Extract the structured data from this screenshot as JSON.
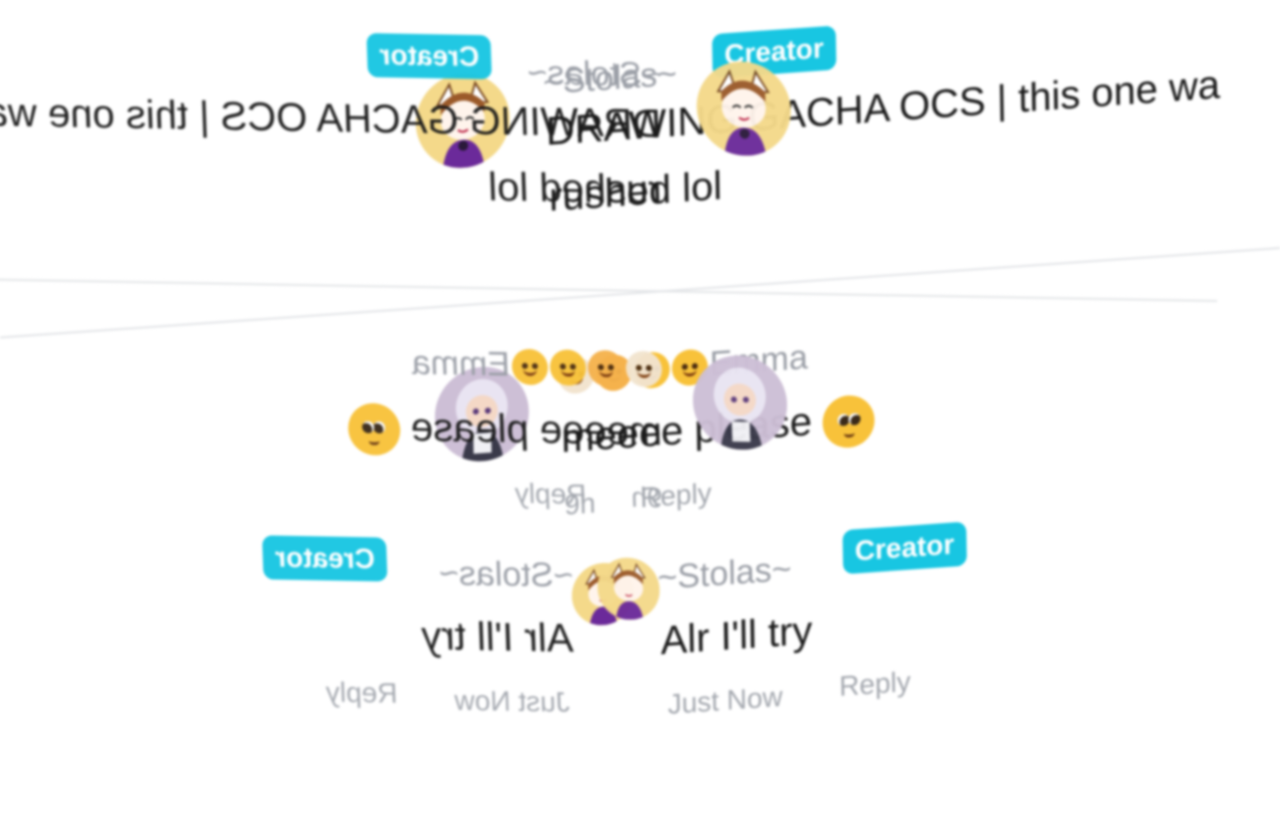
{
  "comments": [
    {
      "author": "~Stolas~",
      "badge": "Creator",
      "text_line1": "DRAWING GACHA OCS | this one wa",
      "text_line2": "rushed lol"
    },
    {
      "author_emojis": [
        "dog-face-emoji",
        "smiling-face-with-hearts-emoji",
        "melting-face-emoji",
        "zany-face-emoji"
      ],
      "author": "Emma",
      "text": "meeee please",
      "text_emoji": "pleading-face-emoji",
      "time": "9h",
      "reply_label": "Reply"
    },
    {
      "author": "~Stolas~",
      "badge": "Creator",
      "text": "Alr I'll try",
      "time": "Just Now",
      "reply_label": "Reply"
    }
  ],
  "colors": {
    "badge": "#18c6e2",
    "name": "#9a9ea6",
    "meta": "#a3a7ae",
    "text": "#1a1a1a",
    "divider": "#e3e5e8"
  }
}
